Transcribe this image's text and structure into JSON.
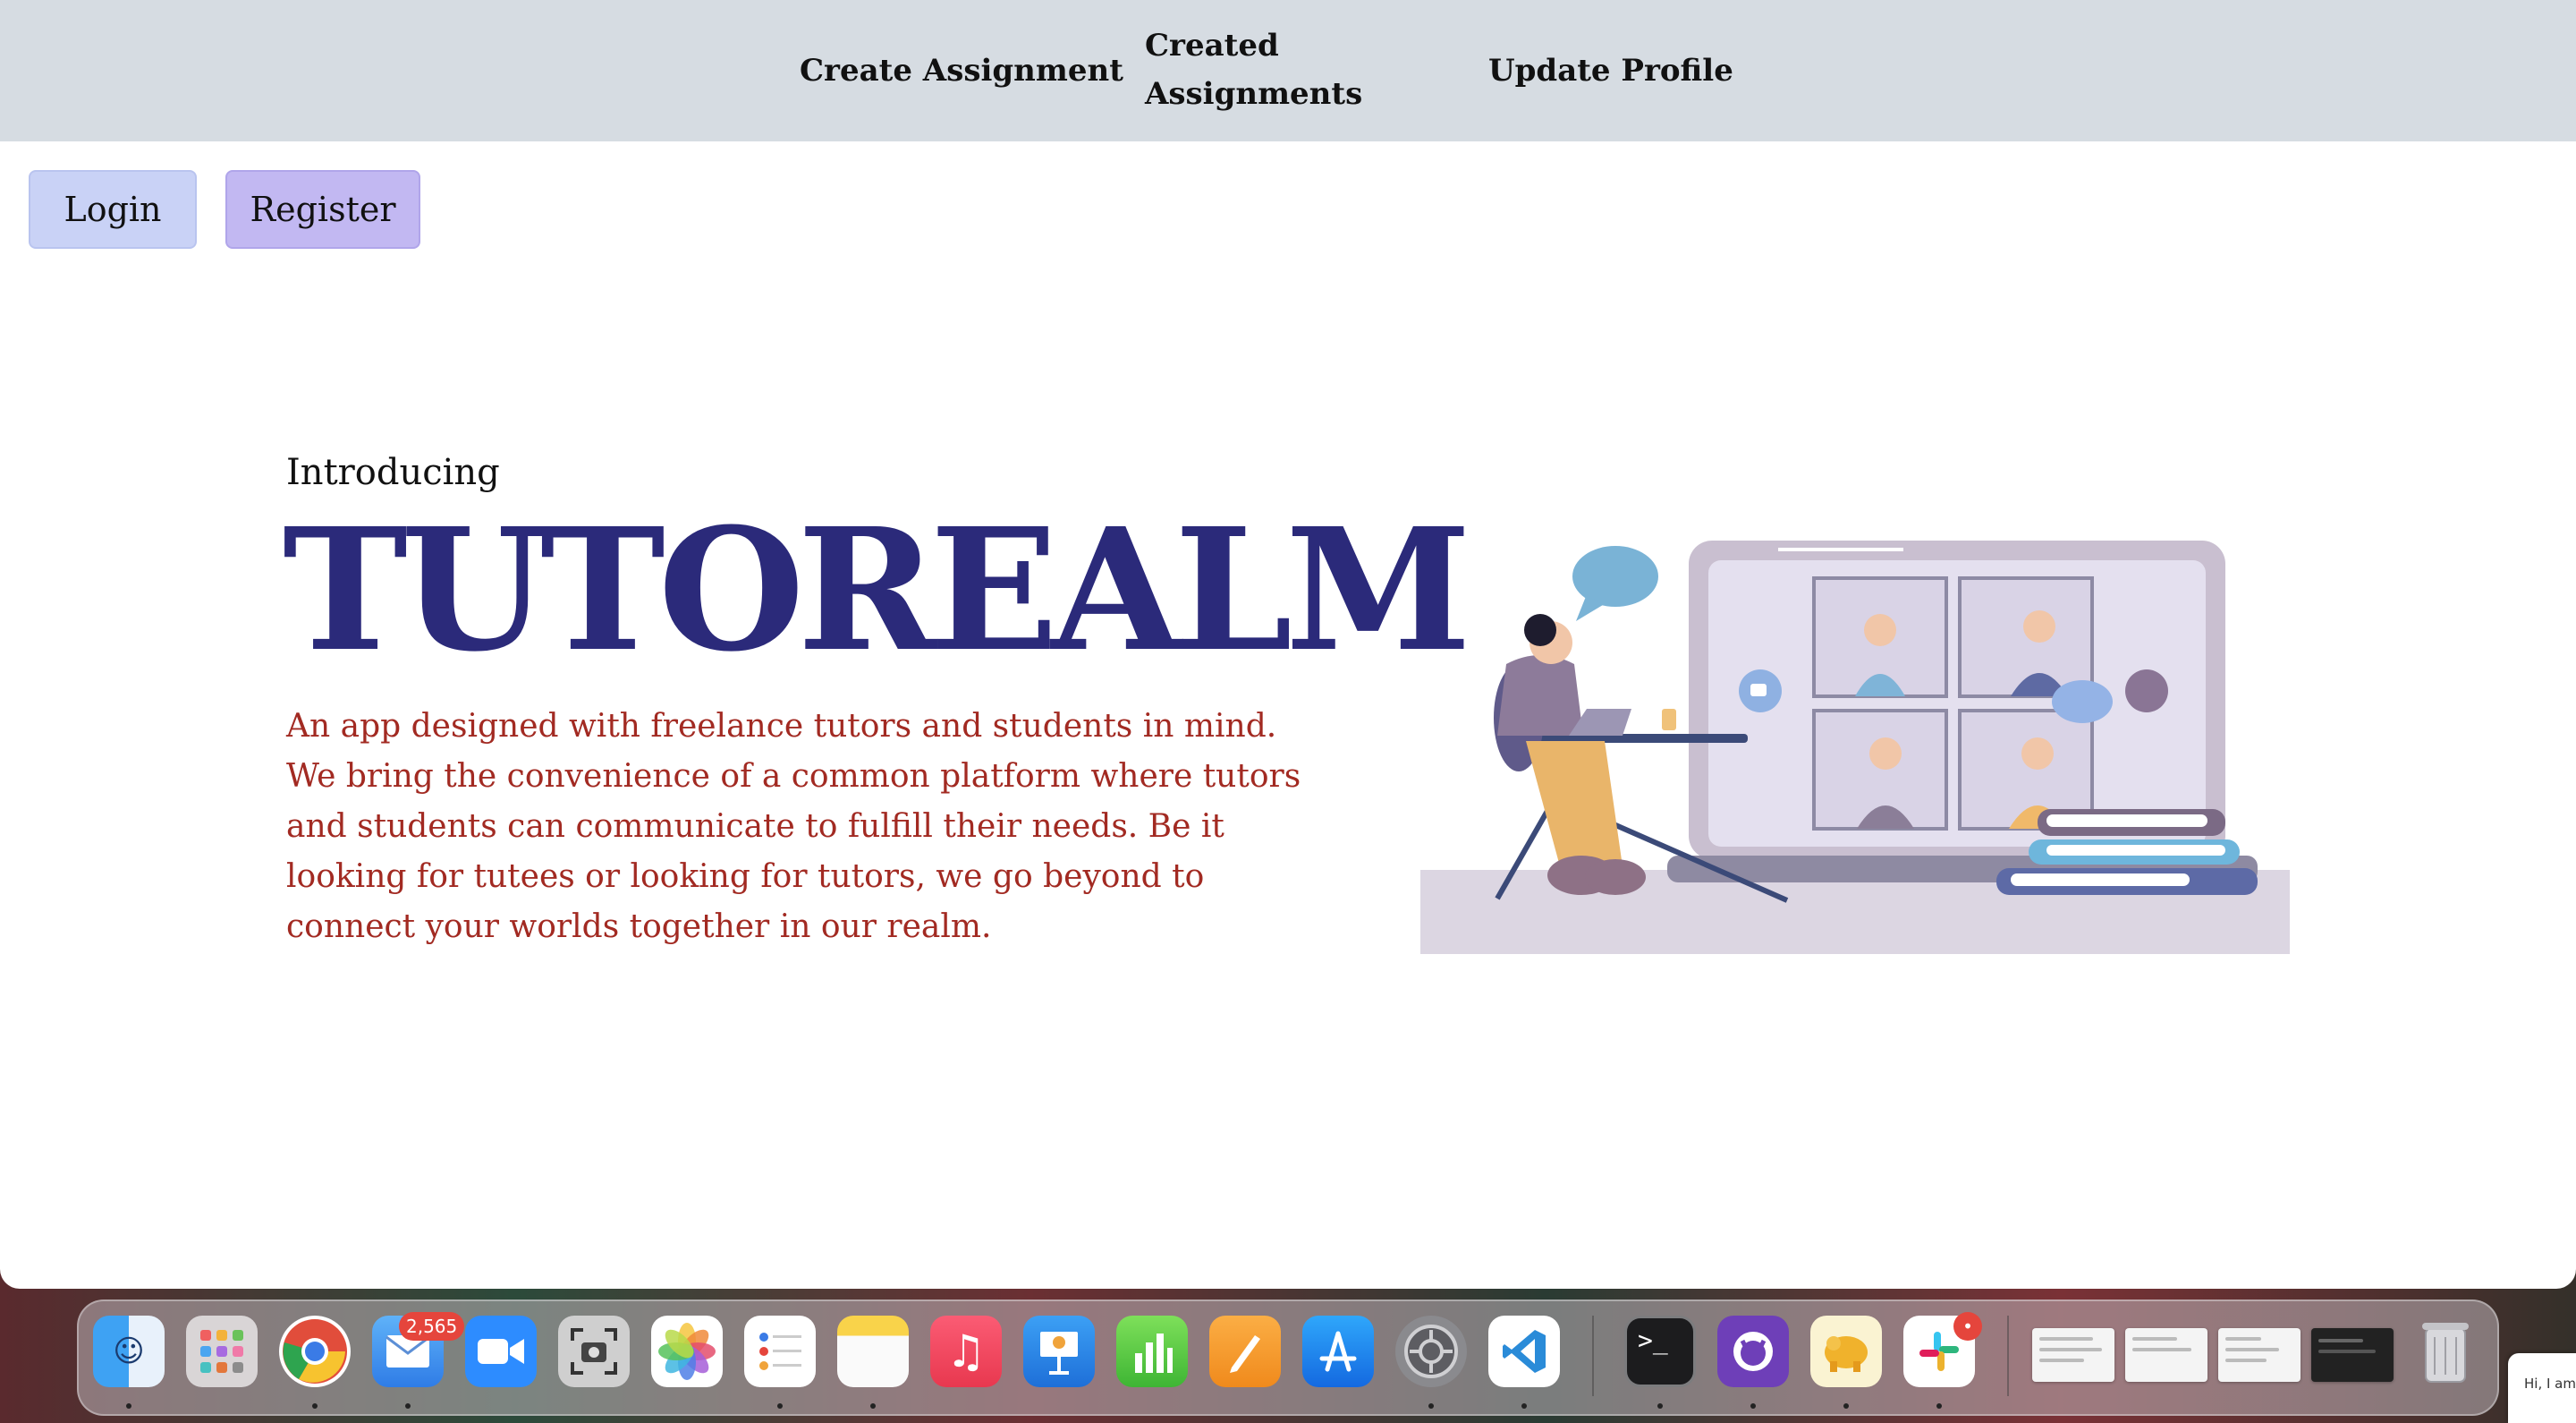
{
  "nav": {
    "create_assignment": "Create Assignment",
    "created_assignments": "Created Assignments",
    "update_profile": "Update Profile"
  },
  "auth": {
    "login": "Login",
    "register": "Register"
  },
  "hero": {
    "intro": "Introducing",
    "brand": "TUTOREALM",
    "description": "An app designed with freelance tutors and students in mind. We bring the convenience of a common platform where tutors and students can communicate to fulfill their needs. Be it looking for tutees or looking for tutors, we go beyond to connect your worlds together in our realm."
  },
  "dock": {
    "apps": [
      {
        "name": "finder-icon"
      },
      {
        "name": "launchpad-icon"
      },
      {
        "name": "chrome-icon"
      },
      {
        "name": "mail-icon",
        "badge": "2,565"
      },
      {
        "name": "zoom-icon"
      },
      {
        "name": "screenshot-icon"
      },
      {
        "name": "photos-icon"
      },
      {
        "name": "reminders-icon"
      },
      {
        "name": "notes-icon"
      },
      {
        "name": "music-icon"
      },
      {
        "name": "keynote-icon"
      },
      {
        "name": "numbers-icon"
      },
      {
        "name": "pages-icon"
      },
      {
        "name": "app-store-icon"
      },
      {
        "name": "system-settings-icon"
      },
      {
        "name": "vscode-icon"
      },
      {
        "name": "terminal-icon"
      },
      {
        "name": "github-desktop-icon"
      },
      {
        "name": "tableplus-icon"
      },
      {
        "name": "slack-icon",
        "badge": "•"
      }
    ],
    "corner_note": "Hi, I am has help alongsi"
  },
  "colors": {
    "nav_bg": "#d6dce2",
    "login_bg": "#c9d2f6",
    "register_bg": "#c2b8f2",
    "brand": "#2b2a7a",
    "description": "#a22a22"
  }
}
